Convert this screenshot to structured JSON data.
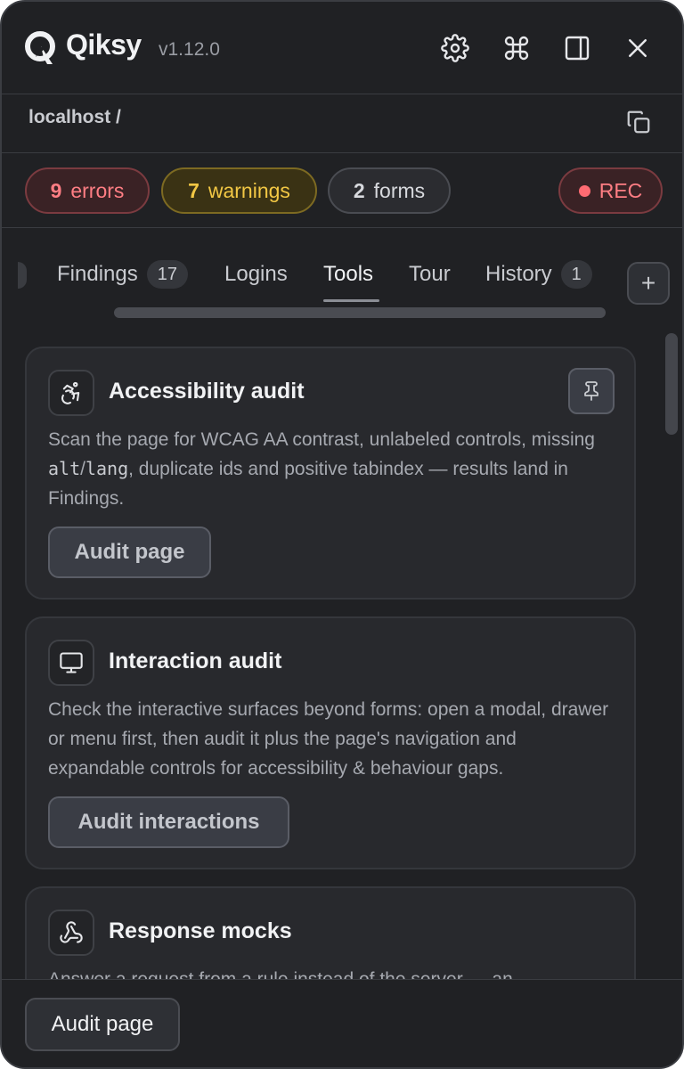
{
  "app": {
    "brand": "Qiksy",
    "version": "v1.12.0",
    "icons": {
      "logo": "q-bolt-logo",
      "settings": "gear-icon",
      "shortcuts": "command-icon",
      "layout": "sidebar-toggle-icon",
      "close": "close-icon"
    }
  },
  "url": {
    "text": "localhost /",
    "copy_icon": "copy-icon"
  },
  "status": {
    "errors": {
      "count": "9",
      "label": "errors"
    },
    "warnings": {
      "count": "7",
      "label": "warnings"
    },
    "forms": {
      "count": "2",
      "label": "forms"
    },
    "rec": {
      "label": "REC"
    }
  },
  "tabs": [
    {
      "label": "Findings",
      "count": "17"
    },
    {
      "label": "Logins"
    },
    {
      "label": "Tools",
      "active": true
    },
    {
      "label": "Tour"
    },
    {
      "label": "History",
      "count": "1"
    }
  ],
  "add_tab_label": "+",
  "cards": [
    {
      "title": "Accessibility audit",
      "icon": "accessibility-icon",
      "desc_1": "Scan the page for WCAG AA contrast, unlabeled controls, missing ",
      "code_1": "alt",
      "desc_sep": "/",
      "code_2": "lang",
      "desc_2": ", duplicate ids and positive tabindex — results land in Findings.",
      "button": "Audit page",
      "pinned_icon": "pin-icon"
    },
    {
      "title": "Interaction audit",
      "icon": "monitor-icon",
      "desc": "Check the interactive surfaces beyond forms: open a modal, drawer or menu first, then audit it plus the page's navigation and expandable controls for accessibility & behaviour gaps.",
      "button": "Audit interactions"
    },
    {
      "title": "Response mocks",
      "icon": "webhook-icon",
      "desc": "Answer a request from a rule instead of the server — an"
    }
  ],
  "footer": {
    "button": "Audit page"
  },
  "colors": {
    "background": "#202124",
    "card": "#28292d",
    "error": "#ff7e84",
    "warning": "#f2c744"
  }
}
